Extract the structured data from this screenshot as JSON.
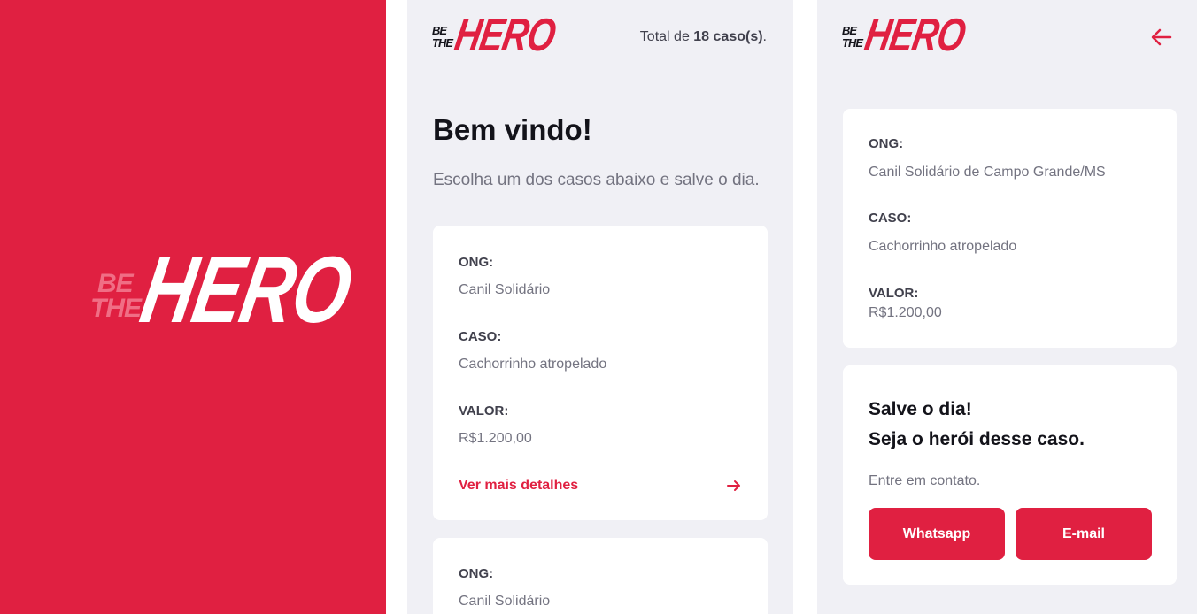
{
  "brand": {
    "be": "BE",
    "the": "THE",
    "hero": "HERO",
    "accent": "#E02041",
    "background": "#F0F0F5"
  },
  "list": {
    "total_prefix": "Total de ",
    "total_count": "18 caso(s)",
    "total_suffix": ".",
    "title": "Bem vindo!",
    "subtitle": "Escolha um dos casos abaixo e salve o dia.",
    "cards": [
      {
        "ong_label": "ONG:",
        "ong_value": "Canil Solidário",
        "caso_label": "CASO:",
        "caso_value": "Cachorrinho atropelado",
        "valor_label": "VALOR:",
        "valor_value": "R$1.200,00",
        "details_link": "Ver mais detalhes"
      },
      {
        "ong_label": "ONG:",
        "ong_value": "Canil Solidário"
      }
    ]
  },
  "detail": {
    "back_icon": "arrow-left-icon",
    "ong_label": "ONG:",
    "ong_value": "Canil Solidário de Campo Grande/MS",
    "caso_label": "CASO:",
    "caso_value": "Cachorrinho atropelado",
    "valor_label": "VALOR:",
    "valor_value": "R$1.200,00",
    "contact": {
      "line1": "Salve o dia!",
      "line2": "Seja o herói desse caso.",
      "text": "Entre em contato.",
      "whatsapp_label": "Whatsapp",
      "email_label": "E-mail"
    }
  }
}
